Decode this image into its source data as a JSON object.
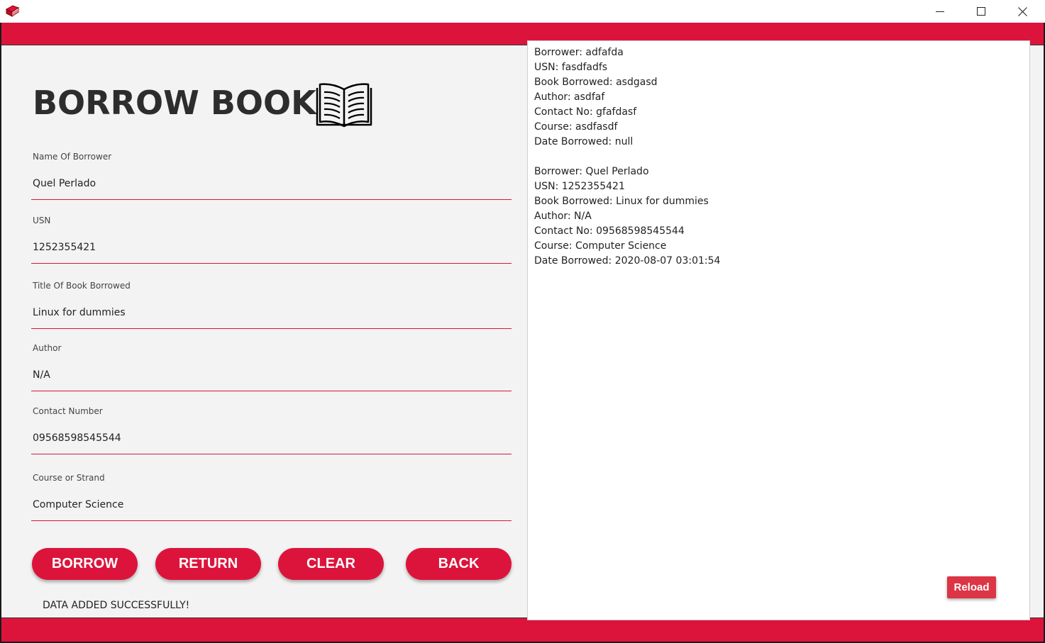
{
  "titlebar": {
    "app_icon": "red-book-icon",
    "minimize_icon": "minimize-icon",
    "maximize_icon": "maximize-icon",
    "close_icon": "close-icon"
  },
  "colors": {
    "accent": "#dc143c",
    "panel_bg": "#f3f3f3",
    "heading": "#2d2d2d"
  },
  "form": {
    "title": "BORROW BOOK",
    "title_icon": "open-book-icon",
    "fields": [
      {
        "label": "Name Of Borrower",
        "value": "Quel Perlado"
      },
      {
        "label": "USN",
        "value": "1252355421"
      },
      {
        "label": "Title Of Book Borrowed",
        "value": "Linux for dummies"
      },
      {
        "label": "Author",
        "value": "N/A"
      },
      {
        "label": "Contact Number",
        "value": "09568598545544"
      },
      {
        "label": "Course or Strand",
        "value": "Computer Science"
      }
    ],
    "buttons": {
      "borrow": "BORROW",
      "return": "RETURN",
      "clear": "CLEAR",
      "back": "BACK"
    },
    "status": "DATA ADDED SUCCESSFULLY!"
  },
  "records": {
    "entries": [
      [
        "Borrower: adfafda",
        "USN: fasdfadfs",
        "Book Borrowed: asdgasd",
        "Author: asdfaf",
        "Contact No: gfafdasf",
        "Course: asdfasdf",
        "Date Borrowed: null"
      ],
      [
        "Borrower: Quel Perlado",
        "USN: 1252355421",
        "Book Borrowed: Linux for dummies",
        "Author: N/A",
        "Contact No: 09568598545544",
        "Course: Computer Science",
        "Date Borrowed: 2020-08-07 03:01:54"
      ]
    ],
    "reload_label": "Reload"
  }
}
